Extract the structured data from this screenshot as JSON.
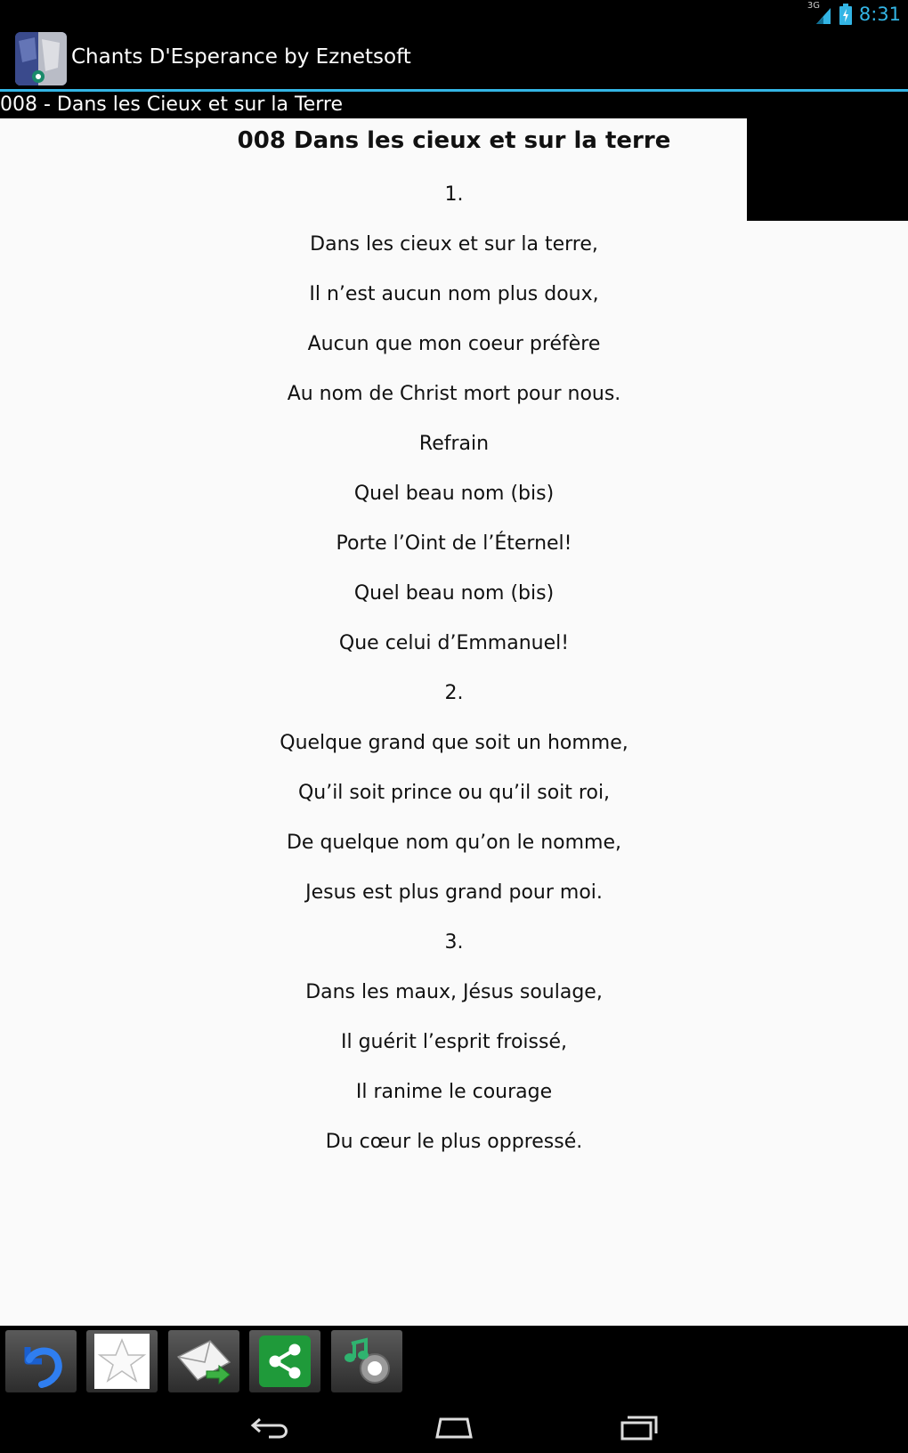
{
  "status_bar": {
    "network_label": "3G",
    "time": "8:31",
    "accent_color": "#33b5e5"
  },
  "action_bar": {
    "title": "Chants D'Esperance by Eznetsoft",
    "icon": "app-logo-icon"
  },
  "subtitle": "008 - Dans les Cieux et sur la Terre",
  "song": {
    "title": "008 Dans les cieux et sur la terre",
    "lines": [
      "1.",
      "Dans les cieux et sur la terre,",
      "Il n’est aucun nom plus doux,",
      "Aucun que mon coeur préfère",
      "Au nom de Christ mort pour nous.",
      "Refrain",
      "Quel beau nom (bis)",
      "Porte l’Oint de l’Éternel!",
      "Quel beau nom (bis)",
      "Que celui d’Emmanuel!",
      "2.",
      "Quelque grand que soit un homme,",
      "Qu’il soit prince ou qu’il soit roi,",
      "De quelque nom qu’on le nomme,",
      "Jesus est plus grand pour moi.",
      "3.",
      "Dans les maux, Jésus soulage,",
      "Il guérit l’esprit froissé,",
      "Il ranime le courage",
      "Du cœur le plus oppressé."
    ]
  },
  "toolbar": {
    "buttons": [
      {
        "name": "back-button",
        "icon": "undo-arrow-icon"
      },
      {
        "name": "favorite-button",
        "icon": "star-icon"
      },
      {
        "name": "email-button",
        "icon": "envelope-icon"
      },
      {
        "name": "share-button",
        "icon": "share-icon"
      },
      {
        "name": "music-button",
        "icon": "music-note-icon"
      }
    ]
  },
  "nav_bar": {
    "buttons": [
      {
        "name": "nav-back-button",
        "icon": "back-icon"
      },
      {
        "name": "nav-home-button",
        "icon": "home-icon"
      },
      {
        "name": "nav-recents-button",
        "icon": "recents-icon"
      }
    ]
  }
}
